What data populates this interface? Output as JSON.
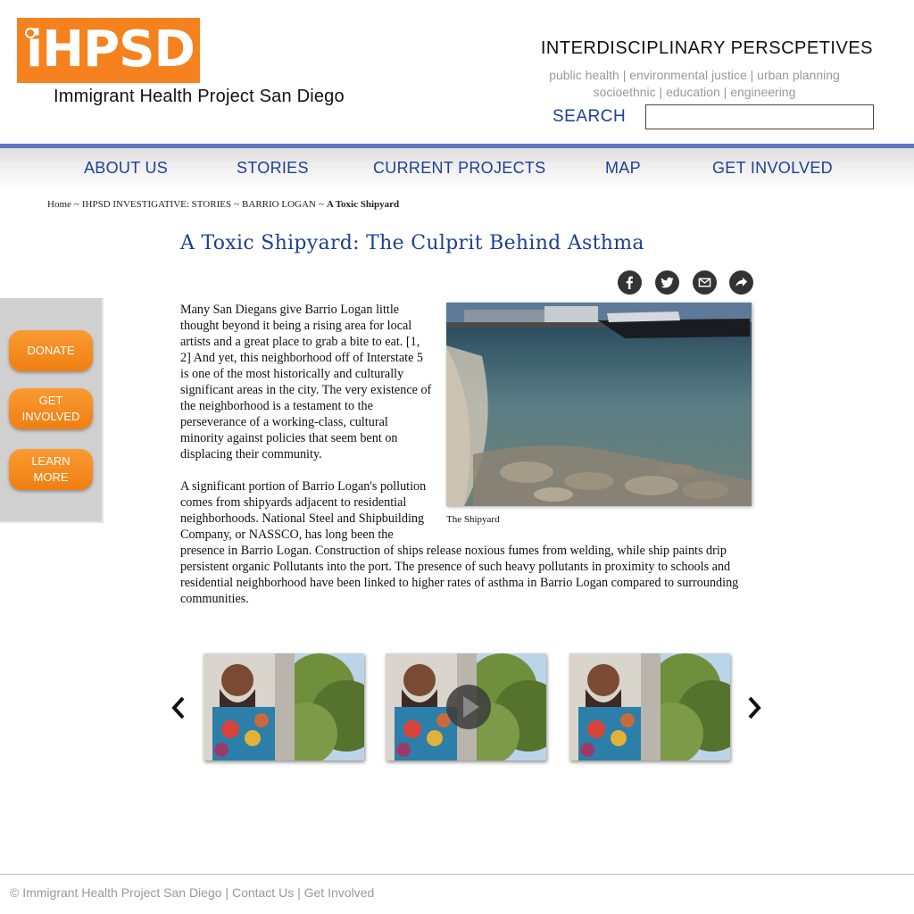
{
  "header": {
    "logo_text": "iHPSD",
    "site_name": "Immigrant Health Project San Diego",
    "title": "INTERDISCIPLINARY PERSCPETIVES",
    "topics_line1": "public health | environmental justice | urban planning",
    "topics_line2": "socioethnic | education | engineering",
    "search_label": "SEARCH",
    "search_value": "",
    "brand_color": "#f5821f",
    "accent_color": "#1e3f96"
  },
  "nav": {
    "items": [
      {
        "label": "ABOUT US"
      },
      {
        "label": "STORIES"
      },
      {
        "label": "CURRENT PROJECTS"
      },
      {
        "label": "MAP"
      },
      {
        "label": "GET INVOLVED"
      }
    ]
  },
  "breadcrumb": {
    "items": [
      "Home",
      "IHPSD INVESTIGATIVE: STORIES",
      "BARRIO LOGAN"
    ],
    "separator": "~",
    "current": "A Toxic Shipyard"
  },
  "article": {
    "title": "A Toxic Shipyard: The Culprit Behind Asthma",
    "share_icons": [
      "facebook-icon",
      "twitter-icon",
      "email-icon",
      "share-icon"
    ],
    "paragraphs": [
      "Many San Diegans give Barrio Logan little thought beyond it being a rising area for local artists and a great place to grab a bite to eat. [1, 2] And yet, this neighborhood off of Interstate 5 is one of the most historically and culturally significant areas in the city. The very existence of the neighborhood is a testament to the perseverance of a working-class, cultural minority against policies that seem bent on displacing their community.",
      "A significant portion of Barrio Logan's pollution comes from shipyards adjacent to residential neighborhoods. National Steel and Shipbuilding Company, or NASSCO, has long been the presence in Barrio Logan. Construction of ships release noxious fumes from welding, while ship paints drip persistent organic Pollutants into the port. The presence of such heavy pollutants in proximity to schools and residential neighborhood have been linked to higher rates of asthma in Barrio Logan compared to surrounding communities."
    ],
    "image_caption": "The Shipyard"
  },
  "sidebar": {
    "buttons": [
      {
        "line1": "DONATE",
        "line2": ""
      },
      {
        "line1": "GET",
        "line2": "INVOLVED"
      },
      {
        "line1": "LEARN",
        "line2": "MORE"
      }
    ]
  },
  "gallery": {
    "thumbnails": [
      "mural-thumbnail",
      "mural-video-thumbnail",
      "mural-thumbnail"
    ]
  },
  "footer": {
    "copyright": "© Immigrant Health Project San Diego",
    "sep": " | ",
    "contact": "Contact Us",
    "get_involved": "Get Involved"
  }
}
